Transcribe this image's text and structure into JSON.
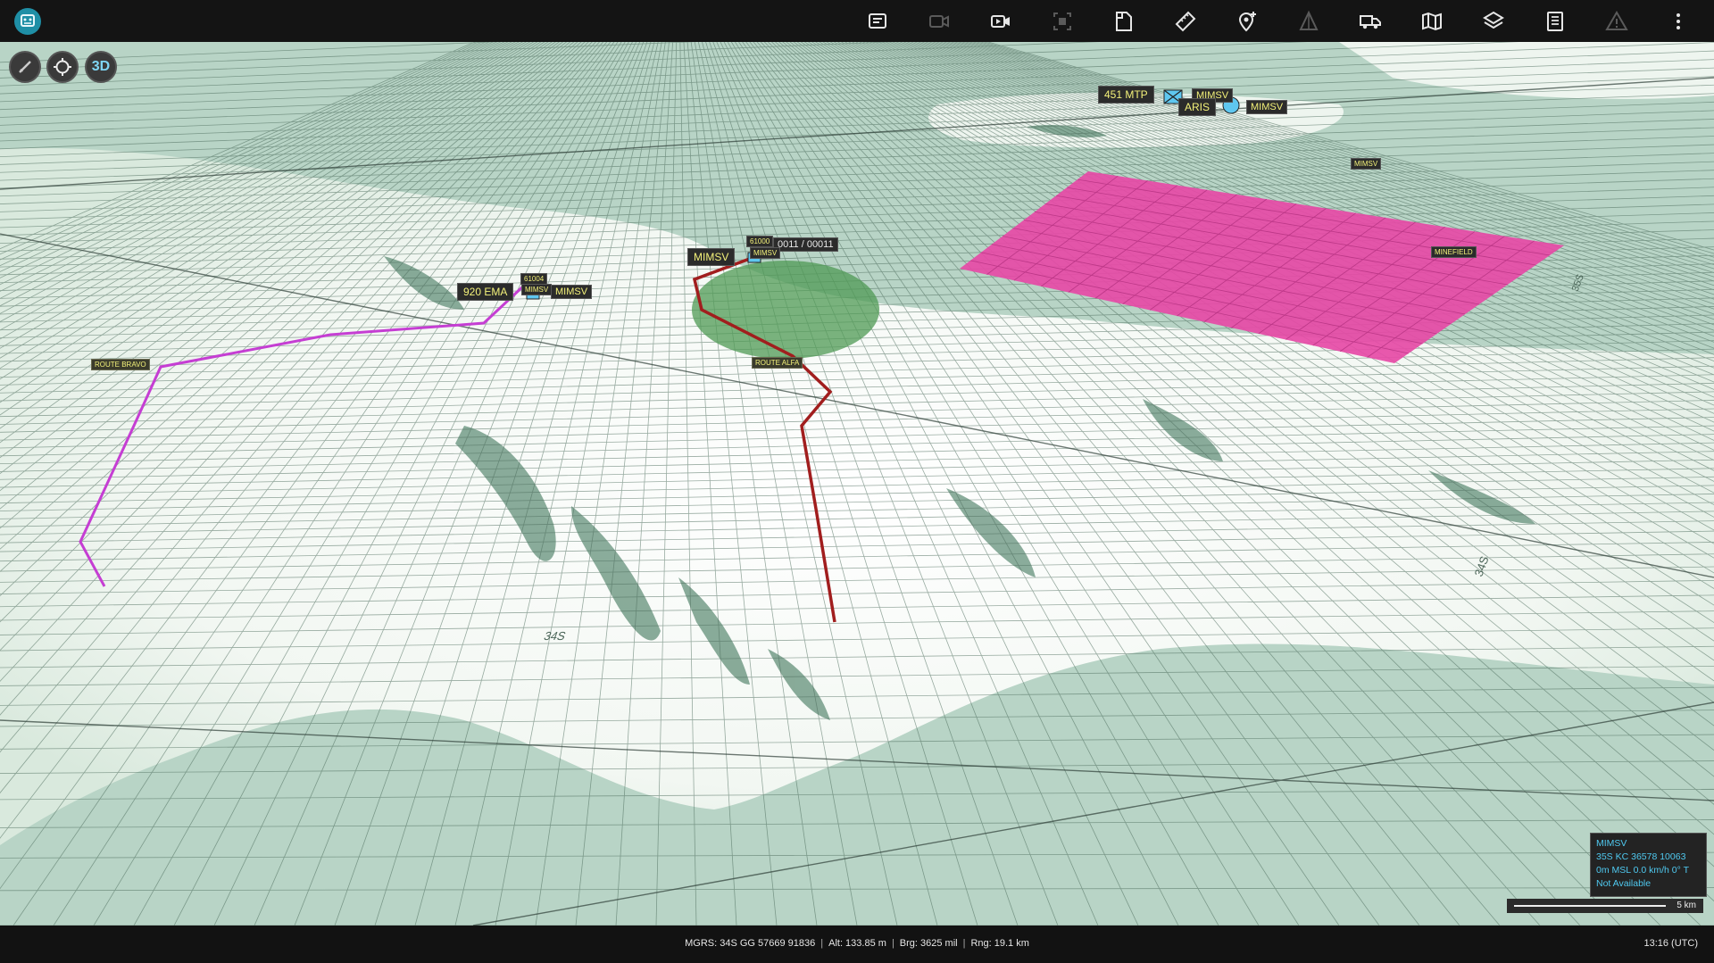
{
  "toolbar": {
    "buttons": [
      {
        "icon": "message-icon",
        "enabled": true
      },
      {
        "icon": "video-camera-icon",
        "enabled": false
      },
      {
        "icon": "video-play-icon",
        "enabled": true
      },
      {
        "icon": "screenshot-icon",
        "enabled": false
      },
      {
        "icon": "document-icon",
        "enabled": true
      },
      {
        "icon": "ruler-icon",
        "enabled": true
      },
      {
        "icon": "add-location-icon",
        "enabled": true
      },
      {
        "icon": "triangle-icon",
        "enabled": false
      },
      {
        "icon": "truck-icon",
        "enabled": true
      },
      {
        "icon": "map-icon",
        "enabled": true
      },
      {
        "icon": "layers-icon",
        "enabled": true
      },
      {
        "icon": "list-icon",
        "enabled": true
      },
      {
        "icon": "warning-icon",
        "enabled": false
      },
      {
        "icon": "more-vertical-icon",
        "enabled": true
      }
    ]
  },
  "map_controls": {
    "compass_icon": "compass-icon",
    "locate_icon": "crosshair-icon",
    "view_mode": "3D"
  },
  "labels": {
    "unit_451": "451 MTP",
    "mimsv_top": "MIMSV",
    "aris": "ARIS",
    "mimsv_top2": "MIMSV",
    "mimsv_area": "MIMSV",
    "minefield": "MINEFIELD",
    "mimsv_center": "MIMSV",
    "track_id_center": "61000",
    "track_count": "0011 / 00011",
    "mimsv_center_small": "MIMSV",
    "unit_920": "920 EMA",
    "track_id_left": "61004",
    "mimsv_left_small": "MIMSV",
    "mimsv_left": "MIMSV",
    "route_bravo": "ROUTE BRAVO",
    "route_alfa": "ROUTE ALFA",
    "grid_zone_1": "34S",
    "grid_zone_2": "34S",
    "grid_zone_3": "35S"
  },
  "route_colors": {
    "bravo": "#c53ed3",
    "alfa": "#a11e1e",
    "minefield": "#e64aa6",
    "range_ring": "#4f9a54"
  },
  "info_panel": {
    "name": "MIMSV",
    "grid": "35S KC 36578 10063",
    "motion": "0m MSL  0.0 km/h  0° T",
    "status": "Not Available"
  },
  "scale": {
    "label": "5 km"
  },
  "statusbar": {
    "mgrs": "MGRS: 34S GG 57669 91836",
    "alt": "Alt: 133.85 m",
    "brg": "Brg: 3625 mil",
    "rng": "Rng: 19.1 km",
    "clock": "13:16 (UTC)"
  }
}
